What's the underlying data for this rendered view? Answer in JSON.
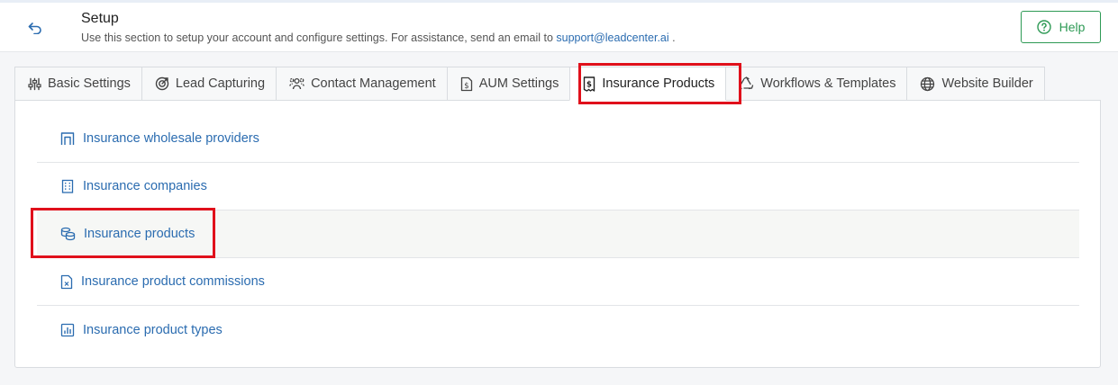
{
  "header": {
    "title": "Setup",
    "subtitle_prefix": "Use this section to setup your account and configure settings. For assistance, send an email to ",
    "support_email": "support@leadcenter.ai",
    "subtitle_suffix": " .",
    "help_label": "Help"
  },
  "tabs": [
    {
      "label": "Basic Settings",
      "icon": "sliders-icon"
    },
    {
      "label": "Lead Capturing",
      "icon": "target-icon"
    },
    {
      "label": "Contact Management",
      "icon": "users-icon"
    },
    {
      "label": "AUM Settings",
      "icon": "dollar-file-icon"
    },
    {
      "label": "Insurance Products",
      "icon": "dollar-receipt-icon",
      "active": true
    },
    {
      "label": "Workflows & Templates",
      "icon": "recycle-icon"
    },
    {
      "label": "Website Builder",
      "icon": "globe-icon"
    }
  ],
  "items": [
    {
      "label": "Insurance wholesale providers",
      "icon": "warehouse-icon"
    },
    {
      "label": "Insurance companies",
      "icon": "building-icon"
    },
    {
      "label": "Insurance products",
      "icon": "coins-icon",
      "selected": true
    },
    {
      "label": "Insurance product commissions",
      "icon": "file-x-icon"
    },
    {
      "label": "Insurance product types",
      "icon": "chart-icon"
    }
  ],
  "colors": {
    "link": "#2b6cb0",
    "help_green": "#2e9a55",
    "highlight_red": "#e0101b"
  }
}
